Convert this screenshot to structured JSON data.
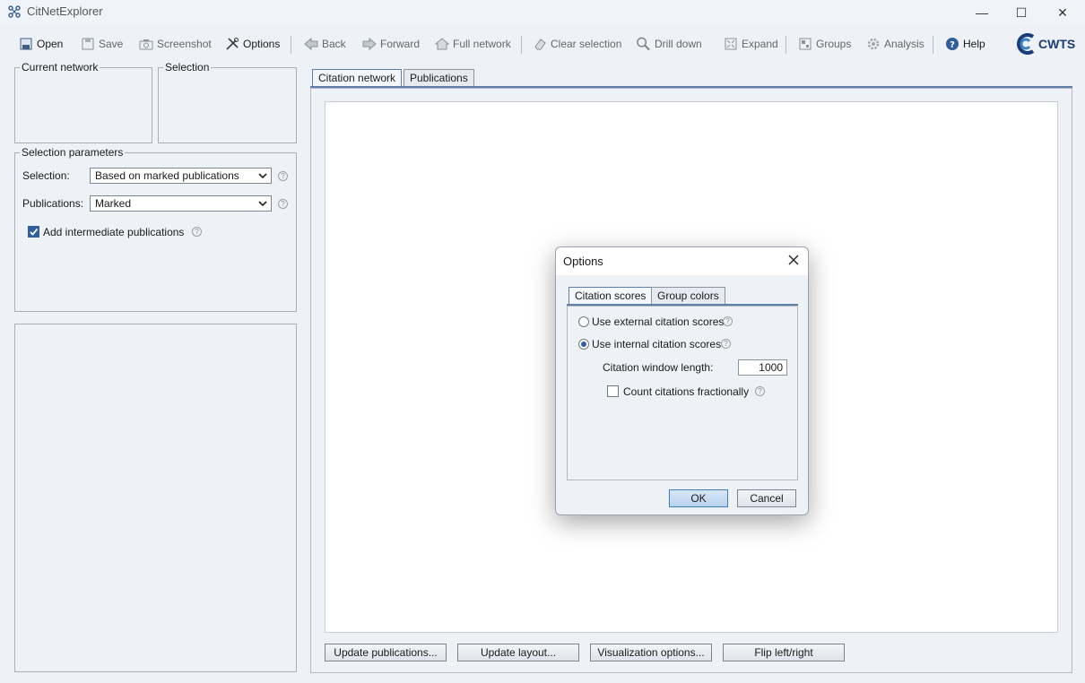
{
  "window": {
    "title": "CitNetExplorer",
    "minimize": "—",
    "maximize": "☐",
    "close": "✕"
  },
  "toolbar": {
    "open": "Open",
    "save": "Save",
    "screenshot": "Screenshot",
    "options": "Options",
    "back": "Back",
    "forward": "Forward",
    "full_network": "Full network",
    "clear_selection": "Clear selection",
    "drill_down": "Drill down",
    "expand": "Expand",
    "groups": "Groups",
    "analysis": "Analysis",
    "help": "Help"
  },
  "brand": {
    "logo_text": "CWTS"
  },
  "left": {
    "current_network": "Current network",
    "selection": "Selection",
    "params_title": "Selection parameters",
    "selection_label": "Selection:",
    "selection_value": "Based on marked publications",
    "publications_label": "Publications:",
    "publications_value": "Marked",
    "add_intermediate": "Add intermediate publications",
    "add_intermediate_checked": true
  },
  "tabs": {
    "citation_network": "Citation network",
    "publications": "Publications"
  },
  "bottom_buttons": {
    "update_publications": "Update publications...",
    "update_layout": "Update layout...",
    "visualization_options": "Visualization options...",
    "flip": "Flip left/right"
  },
  "dialog": {
    "title": "Options",
    "tab_citation_scores": "Citation scores",
    "tab_group_colors": "Group colors",
    "use_external": "Use external citation scores",
    "use_internal": "Use internal citation scores",
    "selected_option": "internal",
    "window_length_label": "Citation window length:",
    "window_length_value": "1000",
    "count_fractionally": "Count citations fractionally",
    "count_fractionally_checked": false,
    "ok": "OK",
    "cancel": "Cancel"
  },
  "help_glyph": "?",
  "colors": {
    "accent": "#2f5f9a",
    "brand": "#1b3c7a"
  }
}
